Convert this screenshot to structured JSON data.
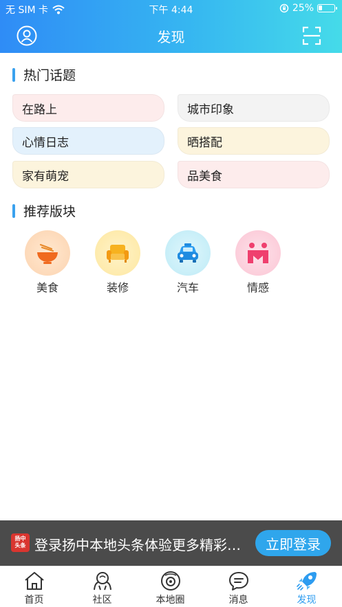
{
  "status_bar": {
    "carrier": "无 SIM 卡",
    "time": "下午 4:44",
    "battery": "25%",
    "battery_level": 0.25
  },
  "nav": {
    "title": "发现",
    "user_icon": "user-icon",
    "scan_icon": "scan-icon"
  },
  "hot_topics": {
    "title": "热门话题",
    "items": [
      {
        "label": "在路上",
        "color": "#fdecec"
      },
      {
        "label": "城市印象",
        "color": "#f3f3f3"
      },
      {
        "label": "心情日志",
        "color": "#e3f1fc"
      },
      {
        "label": "晒搭配",
        "color": "#fcf4dd"
      },
      {
        "label": "家有萌宠",
        "color": "#fcf4dd"
      },
      {
        "label": "品美食",
        "color": "#fdecec"
      }
    ]
  },
  "recommended": {
    "title": "推荐版块",
    "items": [
      {
        "label": "美食",
        "icon": "noodle-bowl-icon"
      },
      {
        "label": "装修",
        "icon": "sofa-icon"
      },
      {
        "label": "汽车",
        "icon": "car-icon"
      },
      {
        "label": "情感",
        "icon": "smile-face-icon"
      }
    ]
  },
  "login_banner": {
    "logo_text": "扬中头条",
    "text": "登录扬中本地头条体验更多精彩内容",
    "button": "立即登录"
  },
  "tabbar": {
    "items": [
      {
        "label": "首页",
        "icon": "home-icon"
      },
      {
        "label": "社区",
        "icon": "community-icon"
      },
      {
        "label": "本地圈",
        "icon": "local-circle-icon"
      },
      {
        "label": "消息",
        "icon": "message-icon"
      },
      {
        "label": "发现",
        "icon": "discover-rocket-icon",
        "active": true
      }
    ],
    "active_color": "#2d9cf0"
  }
}
